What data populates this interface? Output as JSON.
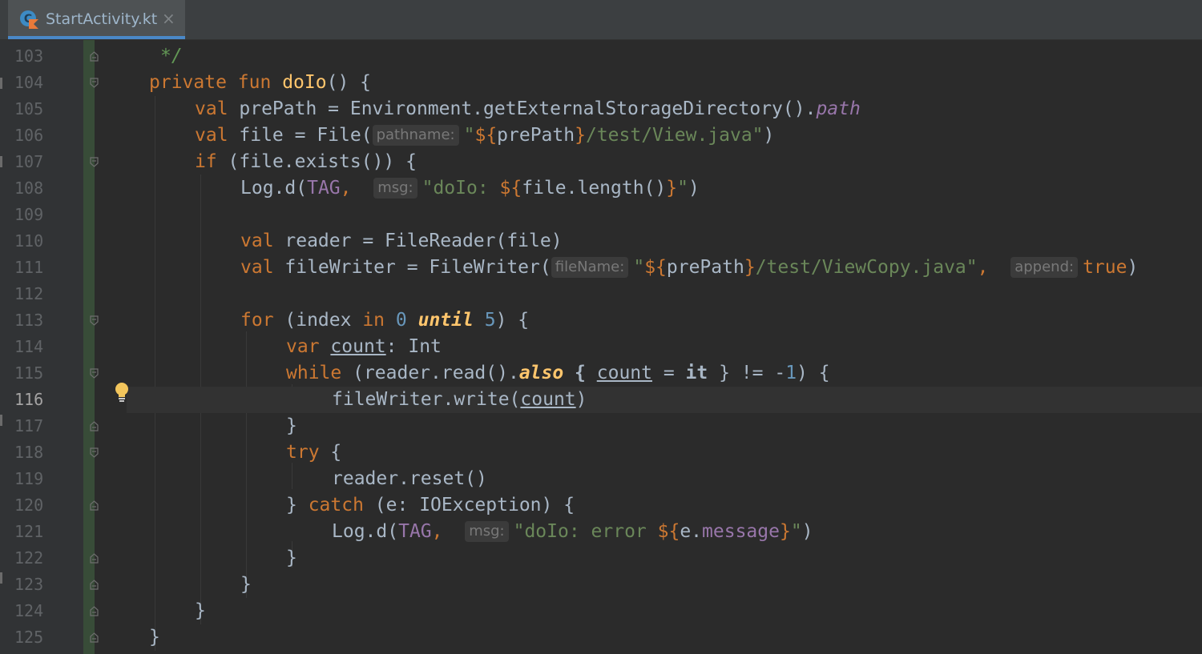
{
  "tab": {
    "file_name": "StartActivity.kt",
    "close_glyph": "×",
    "icon": "kotlin-class-icon"
  },
  "editor": {
    "current_line": "116",
    "lines": [
      {
        "n": "103"
      },
      {
        "n": "104"
      },
      {
        "n": "105"
      },
      {
        "n": "106"
      },
      {
        "n": "107"
      },
      {
        "n": "108"
      },
      {
        "n": "109"
      },
      {
        "n": "110"
      },
      {
        "n": "111"
      },
      {
        "n": "112"
      },
      {
        "n": "113"
      },
      {
        "n": "114"
      },
      {
        "n": "115"
      },
      {
        "n": "116"
      },
      {
        "n": "117"
      },
      {
        "n": "118"
      },
      {
        "n": "119"
      },
      {
        "n": "120"
      },
      {
        "n": "121"
      },
      {
        "n": "122"
      },
      {
        "n": "123"
      },
      {
        "n": "124"
      },
      {
        "n": "125"
      }
    ],
    "code": {
      "l103": [
        "*/"
      ],
      "l104": [
        "private",
        "fun",
        "doIo",
        "() {"
      ],
      "l105": [
        "val",
        " prePath = Environment.getExternalStorageDirectory().",
        "path"
      ],
      "l106": [
        "val",
        " file = File(",
        "pathname:",
        "\"",
        "${",
        "prePath",
        "}",
        "/test/View.java\"",
        ")"
      ],
      "l107": [
        "if",
        " (file.exists()) {"
      ],
      "l108": [
        "Log.d(",
        "TAG",
        ",",
        "msg:",
        "\"doIo: ",
        "${",
        "file.length()",
        "}",
        "\"",
        ")"
      ],
      "l110": [
        "val",
        " reader = FileReader(file)"
      ],
      "l111": [
        "val",
        " fileWriter = FileWriter(",
        "fileName:",
        "\"",
        "${",
        "prePath",
        "}",
        "/test/ViewCopy.java\"",
        ",",
        "append:",
        "true",
        ")"
      ],
      "l113": [
        "for",
        " (index ",
        "in",
        " ",
        "0",
        " ",
        "until",
        " ",
        "5",
        ") {"
      ],
      "l114": [
        "var",
        " ",
        "count",
        ": Int"
      ],
      "l115": [
        "while",
        " (reader.read().",
        "also",
        " { ",
        "count",
        " = ",
        "it",
        " } != -",
        "1",
        ") {"
      ],
      "l116": [
        "fileWriter.write(",
        "count",
        ")"
      ],
      "l117": [
        "}"
      ],
      "l118": [
        "try",
        " {"
      ],
      "l119": [
        "reader.reset()"
      ],
      "l120": [
        "} ",
        "catch",
        " (e: IOException) {"
      ],
      "l121": [
        "Log.d(",
        "TAG",
        ",",
        "msg:",
        "\"doIo: error ",
        "${",
        "e.",
        "message",
        "}",
        "\"",
        ")"
      ],
      "l122": [
        "}"
      ],
      "l123": [
        "}"
      ],
      "l124": [
        "}"
      ],
      "l125": [
        "}"
      ]
    }
  },
  "colors": {
    "background": "#2b2b2b",
    "keyword": "#cc7832",
    "function": "#ffc66d",
    "string": "#6a8759",
    "number": "#6897bb",
    "property": "#9876aa",
    "default": "#a9b7c6",
    "tab_accent": "#4a88c7"
  },
  "gutter_icons": [
    "fold-icon",
    "lightbulb-icon"
  ]
}
